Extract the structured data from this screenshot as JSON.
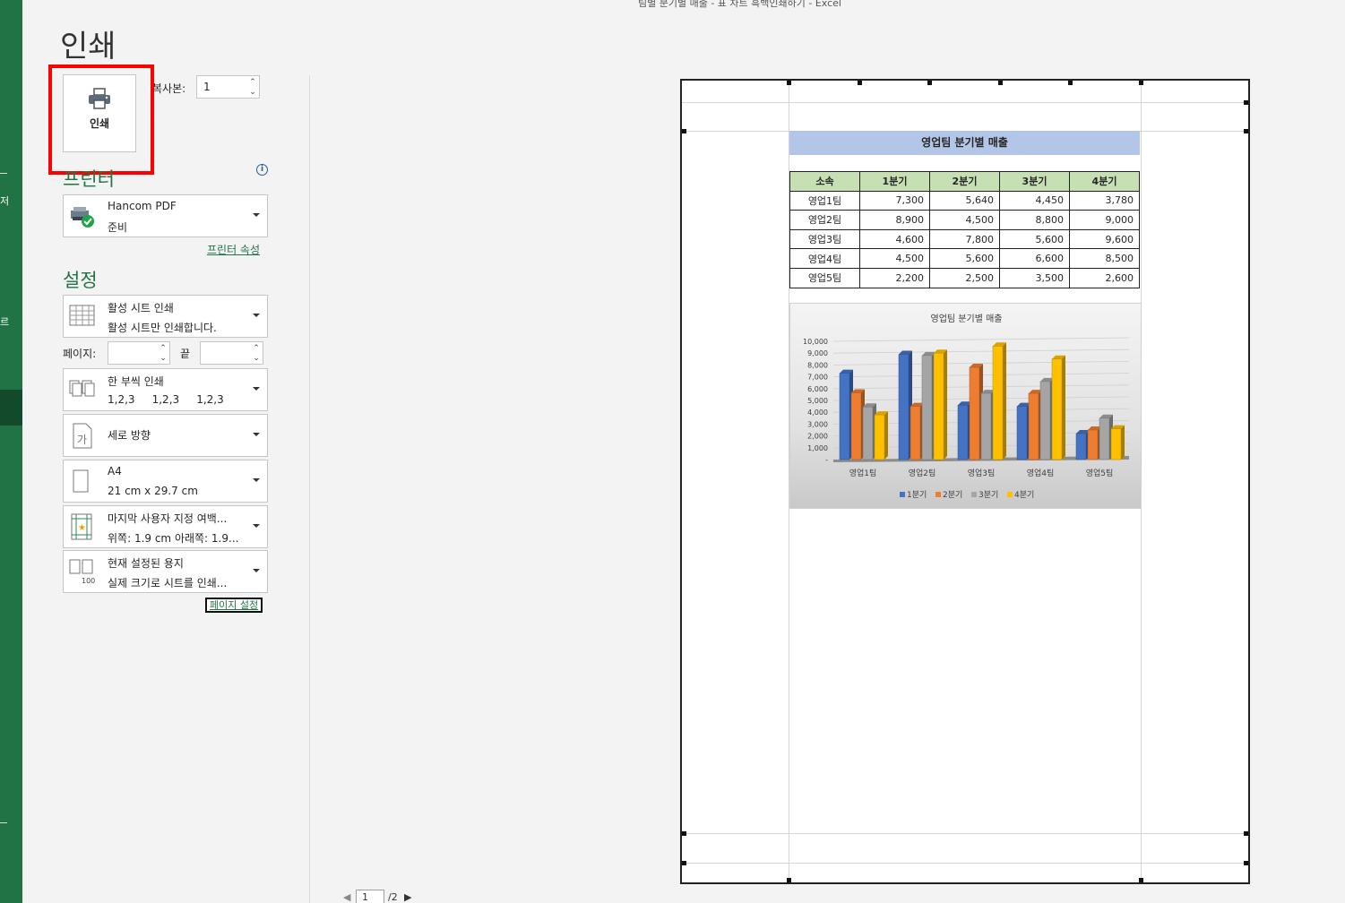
{
  "window_title": "팀별 분기별 매출 - 표 차트 흑백인쇄하기  -  Excel",
  "rail_labels": [
    "저",
    "르"
  ],
  "page_title": "인쇄",
  "print_button_label": "인쇄",
  "copies": {
    "label": "복사본:",
    "value": "1"
  },
  "printer": {
    "section_label": "프린터",
    "name": "Hancom PDF",
    "status": "준비",
    "properties_link": "프린터 속성"
  },
  "settings": {
    "section_label": "설정",
    "sheet_scope": {
      "title": "활성 시트 인쇄",
      "sub": "활성 시트만 인쇄합니다."
    },
    "pages": {
      "label": "페이지:",
      "to_label": "끝"
    },
    "collation": {
      "title": "한 부씩 인쇄",
      "sub": "1,2,3     1,2,3     1,2,3"
    },
    "orientation": {
      "title": "세로 방향"
    },
    "paper": {
      "title": "A4",
      "sub": "21 cm x 29.7 cm"
    },
    "margins": {
      "title": "마지막 사용자 지정 여백...",
      "sub": "위쪽: 1.9 cm 아래쪽: 1.9..."
    },
    "scaling": {
      "title": "현재 설정된 용지",
      "sub": "실제 크기로 시트를 인쇄..."
    },
    "page_setup_link": "페이지 설정"
  },
  "sheet": {
    "title": "영업팀 분기별 매출",
    "headers": [
      "소속",
      "1분기",
      "2분기",
      "3분기",
      "4분기"
    ],
    "rows": [
      {
        "team": "영업1팀",
        "q": [
          "7,300",
          "5,640",
          "4,450",
          "3,780"
        ]
      },
      {
        "team": "영업2팀",
        "q": [
          "8,900",
          "4,500",
          "8,800",
          "9,000"
        ]
      },
      {
        "team": "영업3팀",
        "q": [
          "4,600",
          "7,800",
          "5,600",
          "9,600"
        ]
      },
      {
        "team": "영업4팀",
        "q": [
          "4,500",
          "5,600",
          "6,600",
          "8,500"
        ]
      },
      {
        "team": "영업5팀",
        "q": [
          "2,200",
          "2,500",
          "3,500",
          "2,600"
        ]
      }
    ]
  },
  "chart_data": {
    "type": "bar",
    "title": "영업팀 분기별 매출",
    "categories": [
      "영업1팀",
      "영업2팀",
      "영업3팀",
      "영업4팀",
      "영업5팀"
    ],
    "series": [
      {
        "name": "1분기",
        "color": "#4472c4",
        "values": [
          7300,
          8900,
          4600,
          4500,
          2200
        ]
      },
      {
        "name": "2분기",
        "color": "#ed7d31",
        "values": [
          5640,
          4500,
          7800,
          5600,
          2500
        ]
      },
      {
        "name": "3분기",
        "color": "#a5a5a5",
        "values": [
          4450,
          8800,
          5600,
          6600,
          3500
        ]
      },
      {
        "name": "4분기",
        "color": "#ffc000",
        "values": [
          3780,
          9000,
          9600,
          8500,
          2600
        ]
      }
    ],
    "ylim": [
      0,
      10000
    ],
    "yticks": [
      "10,000",
      "9,000",
      "8,000",
      "7,000",
      "6,000",
      "5,000",
      "4,000",
      "3,000",
      "2,000",
      "1,000",
      "-"
    ],
    "legend_position": "bottom",
    "grid": true
  },
  "pager": {
    "current": "1",
    "total": "/2"
  },
  "colors": {
    "accent": "#217346",
    "highlight": "#ff0000"
  }
}
